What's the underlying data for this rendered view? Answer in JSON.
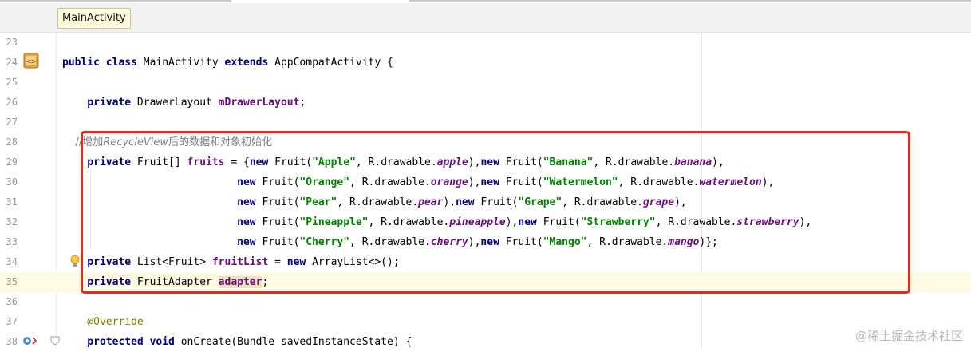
{
  "tab": {
    "label": "MainActivity"
  },
  "colors": {
    "keyword": "#000080",
    "field": "#660e7a",
    "string": "#008000",
    "comment": "#808080",
    "annotation": "#808000",
    "highlight_box": "#e8281d",
    "caret_line": "#fffae3"
  },
  "gutter_icons": [
    "implementation-icon",
    "intention-bulb-icon",
    "override-icon",
    "fold-icon"
  ],
  "lines": [
    {
      "num": "23",
      "tokens": []
    },
    {
      "num": "24",
      "tokens": [
        {
          "t": "public class ",
          "c": "kw"
        },
        {
          "t": "MainActivity "
        },
        {
          "t": "extends ",
          "c": "kw"
        },
        {
          "t": "AppCompatActivity {"
        }
      ]
    },
    {
      "num": "25",
      "tokens": []
    },
    {
      "num": "26",
      "tokens": [
        {
          "t": "    private ",
          "c": "kw"
        },
        {
          "t": "DrawerLayout "
        },
        {
          "t": "mDrawerLayout",
          "c": "fld"
        },
        {
          "t": ";"
        }
      ]
    },
    {
      "num": "27",
      "tokens": []
    },
    {
      "num": "28",
      "tokens": [
        {
          "t": "    //增加",
          "c": "cmt"
        },
        {
          "t": "RecycleView",
          "c": "cmti"
        },
        {
          "t": "后的数据和对象初始化",
          "c": "cmt"
        }
      ]
    },
    {
      "num": "29",
      "tokens": [
        {
          "t": "    private ",
          "c": "kw"
        },
        {
          "t": "Fruit[] "
        },
        {
          "t": "fruits",
          "c": "fld"
        },
        {
          "t": " = {"
        },
        {
          "t": "new ",
          "c": "kw"
        },
        {
          "t": "Fruit("
        },
        {
          "t": "\"Apple\"",
          "c": "str"
        },
        {
          "t": ", R.drawable."
        },
        {
          "t": "apple",
          "c": "fldi"
        },
        {
          "t": "),"
        },
        {
          "t": "new ",
          "c": "kw"
        },
        {
          "t": "Fruit("
        },
        {
          "t": "\"Banana\"",
          "c": "str"
        },
        {
          "t": ", R.drawable."
        },
        {
          "t": "banana",
          "c": "fldi"
        },
        {
          "t": "),"
        }
      ]
    },
    {
      "num": "30",
      "tokens": [
        {
          "t": "                            new ",
          "c": "kw"
        },
        {
          "t": "Fruit("
        },
        {
          "t": "\"Orange\"",
          "c": "str"
        },
        {
          "t": ", R.drawable."
        },
        {
          "t": "orange",
          "c": "fldi"
        },
        {
          "t": "),"
        },
        {
          "t": "new ",
          "c": "kw"
        },
        {
          "t": "Fruit("
        },
        {
          "t": "\"Watermelon\"",
          "c": "str"
        },
        {
          "t": ", R.drawable."
        },
        {
          "t": "watermelon",
          "c": "fldi"
        },
        {
          "t": "),"
        }
      ]
    },
    {
      "num": "31",
      "tokens": [
        {
          "t": "                            new ",
          "c": "kw"
        },
        {
          "t": "Fruit("
        },
        {
          "t": "\"Pear\"",
          "c": "str"
        },
        {
          "t": ", R.drawable."
        },
        {
          "t": "pear",
          "c": "fldi"
        },
        {
          "t": "),"
        },
        {
          "t": "new ",
          "c": "kw"
        },
        {
          "t": "Fruit("
        },
        {
          "t": "\"Grape\"",
          "c": "str"
        },
        {
          "t": ", R.drawable."
        },
        {
          "t": "grape",
          "c": "fldi"
        },
        {
          "t": "),"
        }
      ]
    },
    {
      "num": "32",
      "tokens": [
        {
          "t": "                            new ",
          "c": "kw"
        },
        {
          "t": "Fruit("
        },
        {
          "t": "\"Pineapple\"",
          "c": "str"
        },
        {
          "t": ", R.drawable."
        },
        {
          "t": "pineapple",
          "c": "fldi"
        },
        {
          "t": "),"
        },
        {
          "t": "new ",
          "c": "kw"
        },
        {
          "t": "Fruit("
        },
        {
          "t": "\"Strawberry\"",
          "c": "str"
        },
        {
          "t": ", R.drawable."
        },
        {
          "t": "strawberry",
          "c": "fldi"
        },
        {
          "t": "),"
        }
      ]
    },
    {
      "num": "33",
      "tokens": [
        {
          "t": "                            new ",
          "c": "kw"
        },
        {
          "t": "Fruit("
        },
        {
          "t": "\"Cherry\"",
          "c": "str"
        },
        {
          "t": ", R.drawable."
        },
        {
          "t": "cherry",
          "c": "fldi"
        },
        {
          "t": "),"
        },
        {
          "t": "new ",
          "c": "kw"
        },
        {
          "t": "Fruit("
        },
        {
          "t": "\"Mango\"",
          "c": "str"
        },
        {
          "t": ", R.drawable."
        },
        {
          "t": "mango",
          "c": "fldi"
        },
        {
          "t": ")};"
        }
      ]
    },
    {
      "num": "34",
      "tokens": [
        {
          "t": "    private ",
          "c": "kw"
        },
        {
          "t": "List<Fruit> "
        },
        {
          "t": "fruitList",
          "c": "fld"
        },
        {
          "t": " = "
        },
        {
          "t": "new ",
          "c": "kw"
        },
        {
          "t": "ArrayList<>();"
        }
      ]
    },
    {
      "num": "35",
      "highlight": true,
      "tokens": [
        {
          "t": "    private ",
          "c": "kw"
        },
        {
          "t": "FruitAdapter "
        },
        {
          "t": "adapter",
          "c": "fld",
          "w": true
        },
        {
          "t": ";"
        }
      ]
    },
    {
      "num": "36",
      "tokens": []
    },
    {
      "num": "37",
      "tokens": [
        {
          "t": "    @Override",
          "c": "ann"
        }
      ]
    },
    {
      "num": "38",
      "tokens": [
        {
          "t": "    protected void ",
          "c": "kw"
        },
        {
          "t": "onCreate(Bundle savedInstanceState) {"
        }
      ]
    }
  ],
  "watermark": "@稀土掘金技术社区"
}
